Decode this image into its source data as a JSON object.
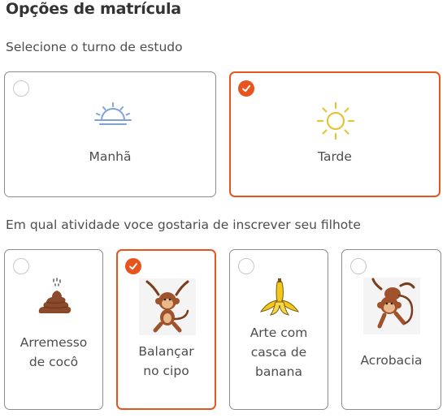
{
  "page": {
    "title": "Opções de matrícula"
  },
  "shift": {
    "question": "Selecione o turno de estudo",
    "options": [
      {
        "label": "Manhã",
        "icon": "sunrise-icon",
        "selected": false
      },
      {
        "label": "Tarde",
        "icon": "sun-icon",
        "selected": true
      }
    ]
  },
  "activity": {
    "question": "Em qual atividade voce gostaria de inscrever seu filhote",
    "options": [
      {
        "label": "Arremesso de cocô",
        "icon": "poop-icon",
        "selected": false
      },
      {
        "label": "Balançar no cipo",
        "icon": "hanging-monkey-icon",
        "selected": true
      },
      {
        "label": "Arte com casca de banana",
        "icon": "banana-peel-icon",
        "selected": false
      },
      {
        "label": "Acrobacia",
        "icon": "acrobat-monkey-icon",
        "selected": false
      }
    ]
  },
  "colors": {
    "accent": "#e8541e",
    "sunrise": "#7fa3d6",
    "sun": "#e3c43a",
    "poop": "#8b4a2b",
    "banana": "#f2c81c",
    "monkey": "#a0522d"
  }
}
